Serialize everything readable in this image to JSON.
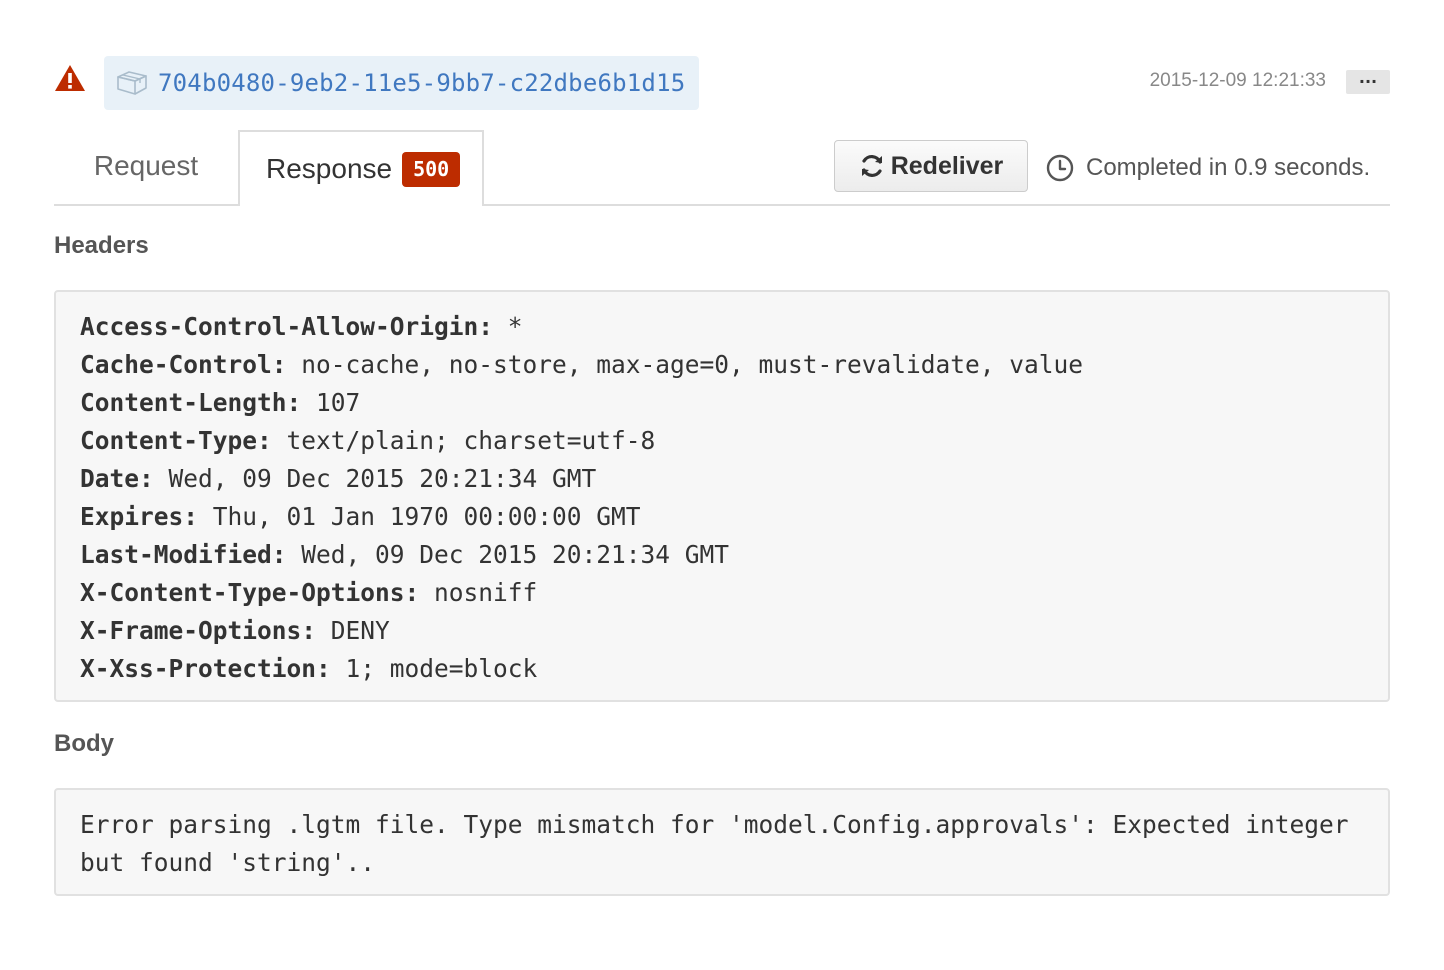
{
  "delivery": {
    "guid": "704b0480-9eb2-11e5-9bb7-c22dbe6b1d15",
    "timestamp": "2015-12-09 12:21:33",
    "more_label": "···",
    "status_icon": "alert-icon",
    "guid_icon": "package-icon"
  },
  "tabs": {
    "request_label": "Request",
    "response_label": "Response",
    "response_status": "500",
    "active": "Response"
  },
  "actions": {
    "redeliver_label": "Redeliver",
    "redeliver_icon": "sync-icon",
    "completed_text": "Completed in 0.9 seconds.",
    "completed_icon": "clock-icon"
  },
  "headers_section": {
    "title": "Headers",
    "items": [
      {
        "name": "Access-Control-Allow-Origin:",
        "value": " *"
      },
      {
        "name": "Cache-Control:",
        "value": " no-cache, no-store, max-age=0, must-revalidate, value"
      },
      {
        "name": "Content-Length:",
        "value": " 107"
      },
      {
        "name": "Content-Type:",
        "value": " text/plain; charset=utf-8"
      },
      {
        "name": "Date:",
        "value": " Wed, 09 Dec 2015 20:21:34 GMT"
      },
      {
        "name": "Expires:",
        "value": " Thu, 01 Jan 1970 00:00:00 GMT"
      },
      {
        "name": "Last-Modified:",
        "value": " Wed, 09 Dec 2015 20:21:34 GMT"
      },
      {
        "name": "X-Content-Type-Options:",
        "value": " nosniff"
      },
      {
        "name": "X-Frame-Options:",
        "value": " DENY"
      },
      {
        "name": "X-Xss-Protection:",
        "value": " 1; mode=block"
      }
    ]
  },
  "body_section": {
    "title": "Body",
    "content": "Error parsing .lgtm file. Type mismatch for 'model.Config.approvals': Expected integer but found 'string'.."
  },
  "colors": {
    "link": "#4078c0",
    "guid_background": "#e8f1f8",
    "error_badge": "#bd2c00",
    "alert_icon": "#bd2c00",
    "code_background": "#f7f7f7"
  }
}
